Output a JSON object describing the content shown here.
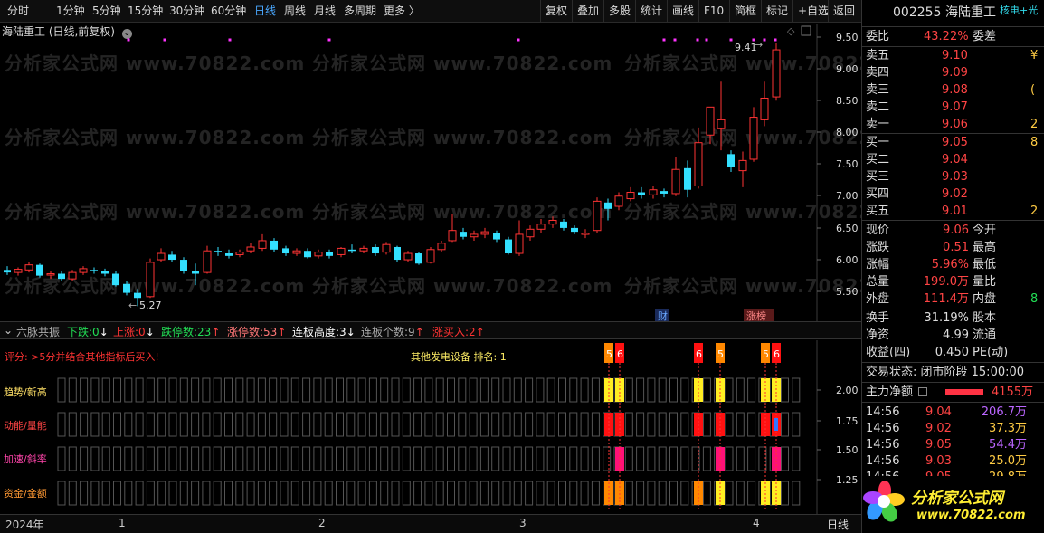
{
  "toolbar": {
    "periods": [
      "分时",
      "1分钟",
      "5分钟",
      "15分钟",
      "30分钟",
      "60分钟",
      "日线",
      "周线",
      "月线",
      "多周期",
      "更多 〉"
    ],
    "active_period": "日线",
    "right_buttons": [
      "复权",
      "叠加",
      "多股",
      "统计",
      "画线",
      "F10",
      "简框",
      "标记",
      "+自选",
      "返回"
    ]
  },
  "chart_title": "海陆重工 (日线,前复权)",
  "price_axis": [
    "9.50",
    "9.00",
    "8.50",
    "8.00",
    "7.50",
    "7.00",
    "6.50",
    "6.00",
    "5.50"
  ],
  "annotations": {
    "high": "9.41",
    "low": "5.27",
    "tag_cai": "财",
    "tag_zhangbang": "涨榜"
  },
  "watermark": "分析家公式网 www.70822.com",
  "indicator_bar": {
    "name": "六脉共振",
    "items": [
      {
        "label": "下跌:",
        "value": "0",
        "arrow": "↓"
      },
      {
        "label": "上涨:",
        "value": "0",
        "arrow": "↓"
      },
      {
        "label": "跌停数:",
        "value": "23",
        "arrow": "↑"
      },
      {
        "label": "涨停数:",
        "value": "53",
        "arrow": "↑"
      },
      {
        "label": "连板高度:",
        "value": "3",
        "arrow": "↓"
      },
      {
        "label": "连板个数:",
        "value": "9",
        "arrow": "↑"
      },
      {
        "label": "涨买入:",
        "value": "2",
        "arrow": "↑"
      }
    ]
  },
  "indicator_panel": {
    "score_text": "评分: >5分并结合其他指标后买入!",
    "sector_text": "其他发电设备 排名: 1",
    "rows": [
      "趋势/新高",
      "动能/量能",
      "加速/斜率",
      "资金/金额"
    ],
    "axis": [
      "2.00",
      "1.75",
      "1.50",
      "1.25"
    ],
    "score_marks": [
      "5",
      "6",
      "6",
      "5",
      "5",
      "6"
    ]
  },
  "time_axis": {
    "labels": [
      "2024年",
      "1",
      "2",
      "3",
      "4"
    ],
    "period": "日线"
  },
  "right_panel": {
    "header": {
      "code": "002255",
      "name": "海陆重工",
      "tag": "核电+光"
    },
    "weibi": {
      "label": "委比",
      "value": "43.22%",
      "label2": "委差"
    },
    "asks": [
      {
        "label": "卖五",
        "price": "9.10",
        "vol": "¥"
      },
      {
        "label": "卖四",
        "price": "9.09",
        "vol": ""
      },
      {
        "label": "卖三",
        "price": "9.08",
        "vol": "("
      },
      {
        "label": "卖二",
        "price": "9.07",
        "vol": ""
      },
      {
        "label": "卖一",
        "price": "9.06",
        "vol": "2"
      }
    ],
    "bids": [
      {
        "label": "买一",
        "price": "9.05",
        "vol": "8"
      },
      {
        "label": "买二",
        "price": "9.04",
        "vol": ""
      },
      {
        "label": "买三",
        "price": "9.03",
        "vol": ""
      },
      {
        "label": "买四",
        "price": "9.02",
        "vol": ""
      },
      {
        "label": "买五",
        "price": "9.01",
        "vol": "2"
      }
    ],
    "quote": [
      {
        "l1": "现价",
        "v1": "9.06",
        "l2": "今开"
      },
      {
        "l1": "涨跌",
        "v1": "0.51",
        "l2": "最高"
      },
      {
        "l1": "涨幅",
        "v1": "5.96%",
        "l2": "最低"
      },
      {
        "l1": "总量",
        "v1": "199.0万",
        "l2": "量比"
      },
      {
        "l1": "外盘",
        "v1": "111.4万",
        "l2": "内盘",
        "v2": "8"
      }
    ],
    "stats": [
      {
        "l1": "换手",
        "v1": "31.19%",
        "l2": "股本"
      },
      {
        "l1": "净资",
        "v1": "4.99",
        "l2": "流通"
      },
      {
        "l1": "收益(四)",
        "v1": "0.450",
        "l2": "PE(动)"
      }
    ],
    "trade_status": "交易状态: 闭市阶段 15:00:00",
    "main_flow": {
      "label": "主力净额",
      "value": "4155万"
    },
    "ticks": [
      {
        "time": "14:56",
        "price": "9.04",
        "vol": "206.7万"
      },
      {
        "time": "14:56",
        "price": "9.02",
        "vol": "37.3万"
      },
      {
        "time": "14:56",
        "price": "9.05",
        "vol": "54.4万"
      },
      {
        "time": "14:56",
        "price": "9.03",
        "vol": "25.0万"
      },
      {
        "time": "14:56",
        "price": "9.05",
        "vol": "29.8万"
      }
    ],
    "logo": {
      "text": "分析家公式网",
      "url": "www.70822.com"
    }
  }
}
